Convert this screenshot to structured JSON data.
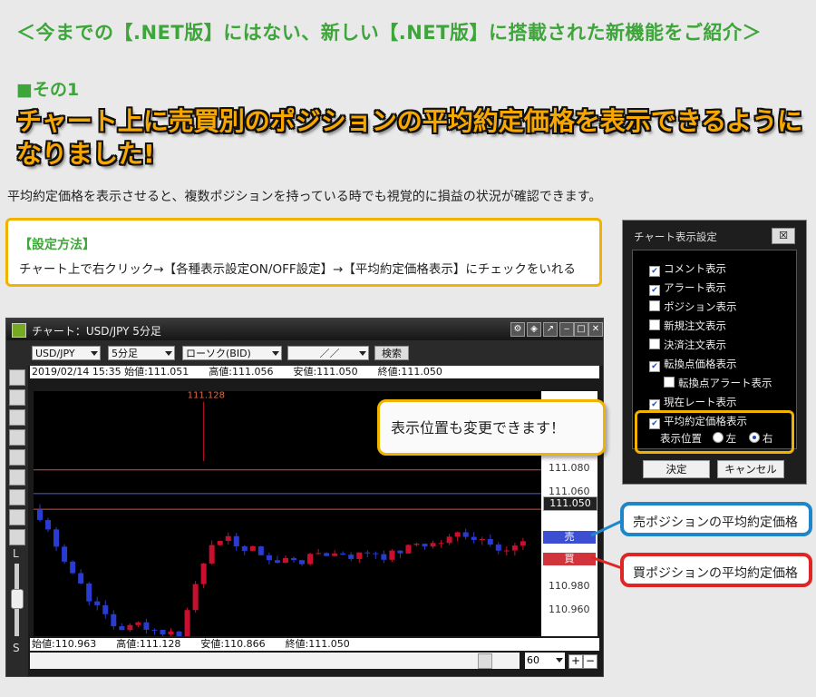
{
  "header": {
    "intro": "＜今までの【.NET版】にはない、新しい【.NET版】に搭載された新機能をご紹介＞",
    "section": "■その1",
    "headline": "チャート上に売買別のポジションの平均約定価格を表示できるようになりました!",
    "description": "平均約定価格を表示させると、複数ポジションを持っている時でも視覚的に損益の状況が確認できます。"
  },
  "howto": {
    "title": "【設定方法】",
    "body": "チャート上で右クリック→【各種表示設定ON/OFF設定】→【平均約定価格表示】にチェックをいれる"
  },
  "chart_window": {
    "title": "チャート：USD/JPY 5分足",
    "pair": "USD/JPY",
    "timeframe": "5分足",
    "chart_type": "ローソク(BID)",
    "date_placeholder": "／／",
    "search_label": "検索",
    "info_top": "2019/02/14 15:35 始値:111.051　　高値:111.056　　安値:111.050　　終値:111.050",
    "info_bottom": "始値:110.963　　高値:111.128　　安値:110.866　　終値:111.050",
    "period": "60",
    "left_labels": [
      "L",
      "S"
    ],
    "colors": {
      "up": "#c8102e",
      "down": "#2a3bd1",
      "sell_line": "#4a63d8",
      "buy_line": "#d84a4a"
    }
  },
  "chart_data": {
    "type": "candlestick",
    "y_ticks": [
      111.08,
      111.06,
      110.98,
      110.96
    ],
    "high_label": "111.128",
    "current_price_label": "111.050",
    "sell_avg_label": "売 111.023",
    "buy_avg_label": "買 111.005",
    "sell_avg": 111.023,
    "buy_avg": 111.005,
    "current_price": 111.05
  },
  "dialog": {
    "title": "チャート表示設定",
    "close_label": "☒",
    "options": [
      {
        "label": "コメント表示",
        "checked": true
      },
      {
        "label": "アラート表示",
        "checked": true
      },
      {
        "label": "ポジション表示",
        "checked": false
      },
      {
        "label": "新規注文表示",
        "checked": false
      },
      {
        "label": "決済注文表示",
        "checked": false
      },
      {
        "label": "転換点価格表示",
        "checked": true
      },
      {
        "label": "転換点アラート表示",
        "checked": false
      },
      {
        "label": "現在レート表示",
        "checked": true
      },
      {
        "label": "平均約定価格表示",
        "checked": true
      }
    ],
    "position_label": "表示位置",
    "left_label": "左",
    "right_label": "右",
    "ok_label": "決定",
    "cancel_label": "キャンセル"
  },
  "callout": "表示位置も変更できます！",
  "labels": {
    "sell": "売ポジションの平均約定価格",
    "buy": "買ポジションの平均約定価格"
  }
}
